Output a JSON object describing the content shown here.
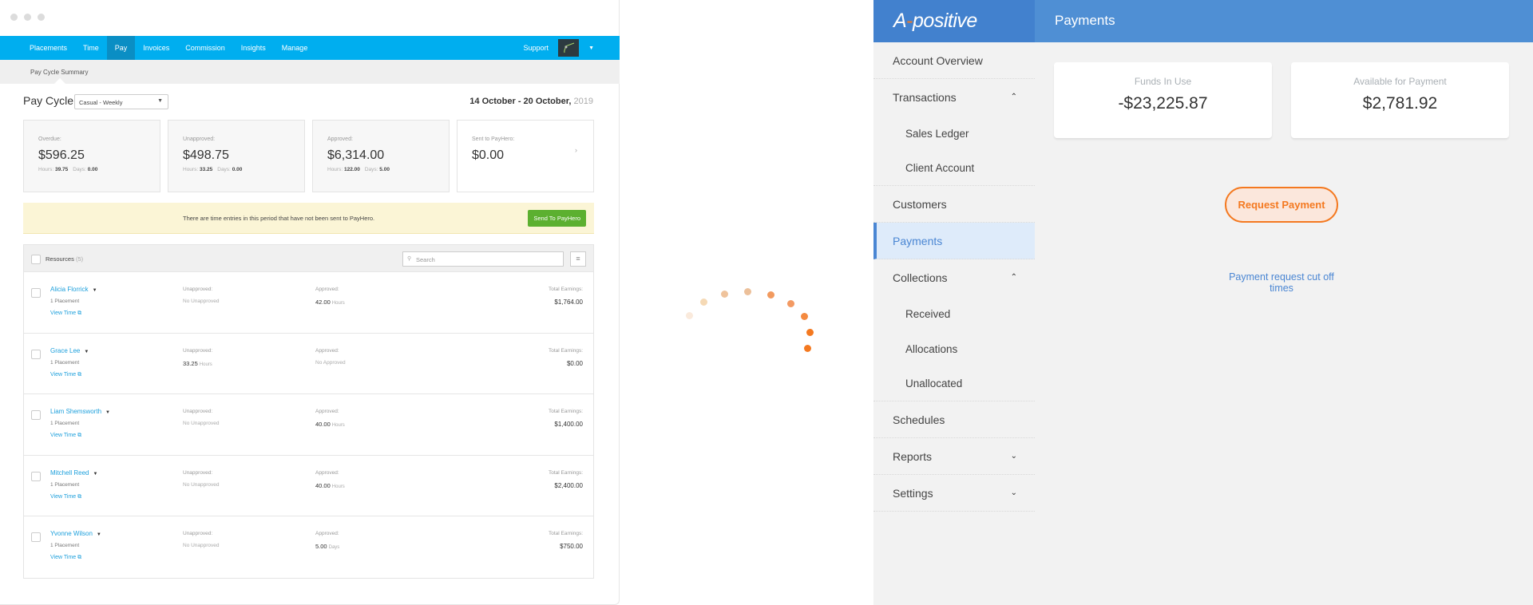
{
  "left_app": {
    "nav": {
      "items": [
        "Placements",
        "Time",
        "Pay",
        "Invoices",
        "Commission",
        "Insights",
        "Manage"
      ],
      "active": "Pay",
      "support": "Support"
    },
    "breadcrumb": "Pay Cycle Summary",
    "pay_cycle": {
      "title": "Pay Cycle",
      "selected": "Casual - Weekly",
      "date_range": "14 October - 20 October,",
      "year": "2019"
    },
    "summary_cards": [
      {
        "label": "Overdue:",
        "value": "$596.25",
        "hours_label": "Hours:",
        "hours": "39.75",
        "days_label": "Days:",
        "days": "0.00"
      },
      {
        "label": "Unapproved:",
        "value": "$498.75",
        "hours_label": "Hours:",
        "hours": "33.25",
        "days_label": "Days:",
        "days": "0.00"
      },
      {
        "label": "Approved:",
        "value": "$6,314.00",
        "hours_label": "Hours:",
        "hours": "122.00",
        "days_label": "Days:",
        "days": "5.00"
      },
      {
        "label": "Sent to PayHero:",
        "value": "$0.00"
      }
    ],
    "alert": {
      "text": "There are time entries in this period that have not been sent to PayHero.",
      "button": "Send To PayHero"
    },
    "resources": {
      "title": "Resources",
      "count": "(5)",
      "search_placeholder": "Search",
      "rows": [
        {
          "name": "Alicia Florrick",
          "placements": "1 Placement",
          "view": "View Time",
          "unapproved_label": "Unapproved:",
          "unapproved": "No Unapproved",
          "unapproved_unit": "",
          "approved_label": "Approved:",
          "approved": "42.00",
          "approved_unit": "Hours",
          "total_label": "Total Earnings:",
          "total": "$1,764.00"
        },
        {
          "name": "Grace Lee",
          "placements": "1 Placement",
          "view": "View Time",
          "unapproved_label": "Unapproved:",
          "unapproved": "33.25",
          "unapproved_unit": "Hours",
          "approved_label": "Approved:",
          "approved": "No Approved",
          "approved_unit": "",
          "total_label": "Total Earnings:",
          "total": "$0.00"
        },
        {
          "name": "Liam Shemsworth",
          "placements": "1 Placement",
          "view": "View Time",
          "unapproved_label": "Unapproved:",
          "unapproved": "No Unapproved",
          "unapproved_unit": "",
          "approved_label": "Approved:",
          "approved": "40.00",
          "approved_unit": "Hours",
          "total_label": "Total Earnings:",
          "total": "$1,400.00"
        },
        {
          "name": "Mitchell Reed",
          "placements": "1 Placement",
          "view": "View Time",
          "unapproved_label": "Unapproved:",
          "unapproved": "No Unapproved",
          "unapproved_unit": "",
          "approved_label": "Approved:",
          "approved": "40.00",
          "approved_unit": "Hours",
          "total_label": "Total Earnings:",
          "total": "$2,400.00"
        },
        {
          "name": "Yvonne Wilson",
          "placements": "1 Placement",
          "view": "View Time",
          "unapproved_label": "Unapproved:",
          "unapproved": "No Unapproved",
          "unapproved_unit": "",
          "approved_label": "Approved:",
          "approved": "5.00",
          "approved_unit": "Days",
          "total_label": "Total Earnings:",
          "total": "$750.00"
        }
      ]
    },
    "colors": {
      "nav": "#00aeef",
      "link": "#1ea0dc",
      "send_button": "#5cb030",
      "alert_bg": "#fbf5d6"
    }
  },
  "loader": {
    "colors": [
      "#faeadc",
      "#f5d9b5",
      "#efc39c",
      "#ecc09a",
      "#f29a5f",
      "#f39a63",
      "#f48a40",
      "#f47920",
      "#f47920"
    ]
  },
  "right_app": {
    "logo": {
      "a": "A",
      "rest": "positive"
    },
    "page_title": "Payments",
    "sidebar": [
      {
        "label": "Account Overview",
        "type": "item"
      },
      {
        "label": "Transactions",
        "type": "item",
        "chevron": "up"
      },
      {
        "label": "Sales Ledger",
        "type": "sub"
      },
      {
        "label": "Client Account",
        "type": "sub"
      },
      {
        "label": "Customers",
        "type": "item"
      },
      {
        "label": "Payments",
        "type": "item",
        "active": true
      },
      {
        "label": "Collections",
        "type": "item",
        "chevron": "up"
      },
      {
        "label": "Received",
        "type": "sub"
      },
      {
        "label": "Allocations",
        "type": "sub"
      },
      {
        "label": "Unallocated",
        "type": "sub"
      },
      {
        "label": "Schedules",
        "type": "item"
      },
      {
        "label": "Reports",
        "type": "item",
        "chevron": "down"
      },
      {
        "label": "Settings",
        "type": "item",
        "chevron": "down"
      }
    ],
    "cards": [
      {
        "label": "Funds In Use",
        "value": "-$23,225.87"
      },
      {
        "label": "Available for Payment",
        "value": "$2,781.92"
      }
    ],
    "request_button": "Request Payment",
    "cutoff_link": "Payment request cut off times",
    "colors": {
      "header": "#4f8fd4",
      "accent": "#f47920",
      "link": "#4a86d3"
    }
  }
}
